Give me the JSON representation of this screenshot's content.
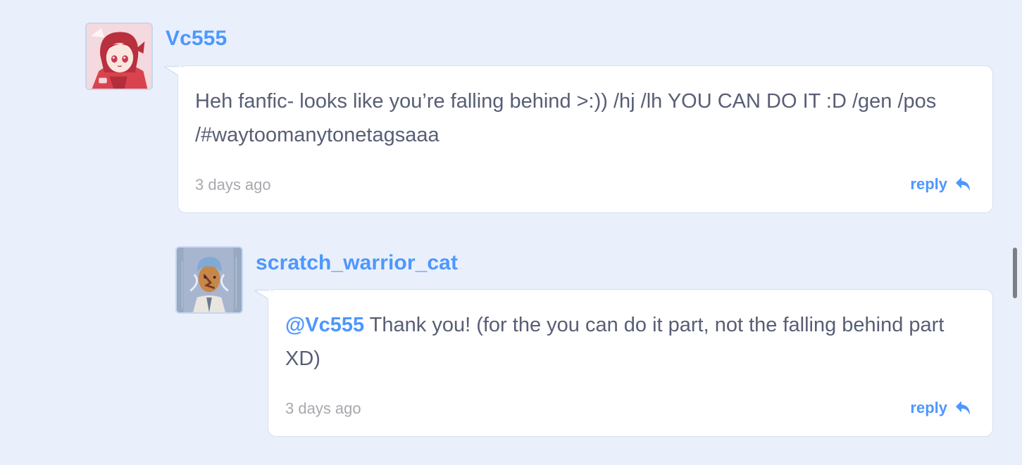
{
  "comments": [
    {
      "username": "Vc555",
      "avatar_icon": "anime-girl-red-hair-avatar",
      "text": "Heh fanfic- looks like you’re falling behind >:)) /hj /lh YOU CAN DO IT :D /gen /pos /#waytoomanytonetagsaaa",
      "time": "3 days ago",
      "reply_label": "reply",
      "reply_icon": "reply-arrow-icon"
    },
    {
      "username": "scratch_warrior_cat",
      "avatar_icon": "character-blue-hair-avatar",
      "mention": "@Vc555",
      "text": " Thank you! (for the you can do it part, not the falling behind part XD)",
      "time": "3 days ago",
      "reply_label": "reply",
      "reply_icon": "reply-arrow-icon"
    }
  ],
  "colors": {
    "background": "#e9f0fb",
    "link": "#4d97ff",
    "text": "#575e75",
    "muted": "#a6a8ad"
  }
}
